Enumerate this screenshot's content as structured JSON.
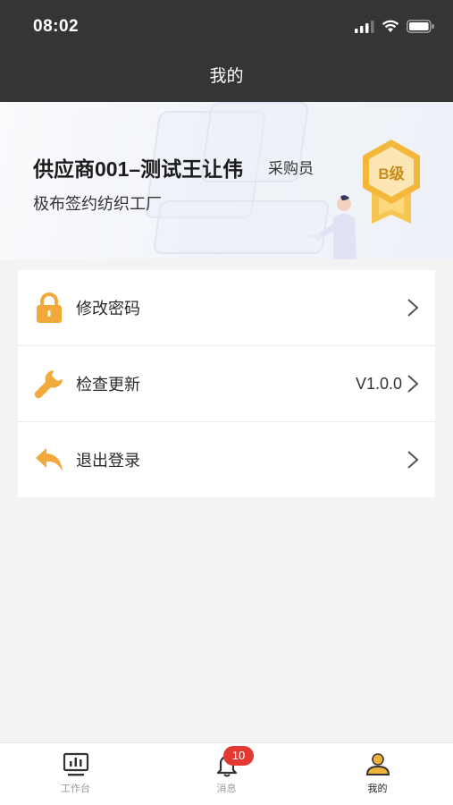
{
  "status_bar": {
    "time": "08:02"
  },
  "nav": {
    "title": "我的"
  },
  "profile": {
    "name": "供应商001–测试王让伟",
    "role": "采购员",
    "company": "极布签约纺织工厂",
    "badge": "B级",
    "badge_color": "#f3b73c"
  },
  "menu": {
    "items": [
      {
        "label": "修改密码",
        "icon": "lock-icon",
        "value": ""
      },
      {
        "label": "检查更新",
        "icon": "wrench-icon",
        "value": "V1.0.0"
      },
      {
        "label": "退出登录",
        "icon": "reply-arrow-icon",
        "value": ""
      }
    ]
  },
  "tabbar": {
    "tabs": [
      {
        "label": "工作台",
        "icon": "monitor-chart-icon",
        "active": false
      },
      {
        "label": "消息",
        "icon": "bell-icon",
        "badge": "10",
        "active": false
      },
      {
        "label": "我的",
        "icon": "user-icon",
        "active": true
      }
    ]
  },
  "colors": {
    "accent": "#f0a93a",
    "header_bg": "#353535",
    "badge_red": "#e23a32"
  }
}
